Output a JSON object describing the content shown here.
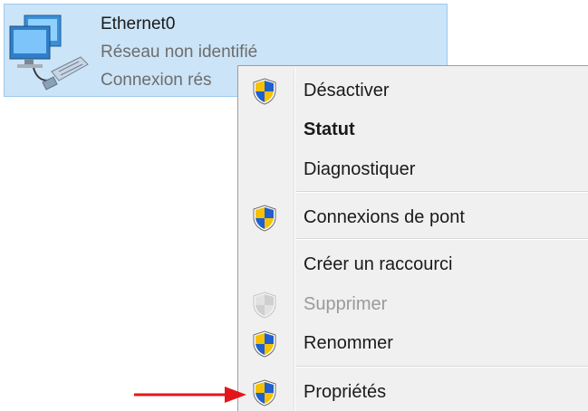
{
  "adapter": {
    "name": "Ethernet0",
    "status": "Réseau non identifié",
    "connection": "Connexion rés"
  },
  "context_menu": {
    "items": [
      {
        "label": "Désactiver",
        "shield": true,
        "bold": false,
        "disabled": false
      },
      {
        "label": "Statut",
        "shield": false,
        "bold": true,
        "disabled": false
      },
      {
        "label": "Diagnostiquer",
        "shield": false,
        "bold": false,
        "disabled": false
      },
      {
        "label": "Connexions de pont",
        "shield": true,
        "bold": false,
        "disabled": false
      },
      {
        "label": "Créer un raccourci",
        "shield": false,
        "bold": false,
        "disabled": false
      },
      {
        "label": "Supprimer",
        "shield": true,
        "bold": false,
        "disabled": true
      },
      {
        "label": "Renommer",
        "shield": true,
        "bold": false,
        "disabled": false
      },
      {
        "label": "Propriétés",
        "shield": true,
        "bold": false,
        "disabled": false
      }
    ]
  },
  "colors": {
    "selection_bg": "#cce4f7",
    "menu_bg": "#f0f0f0",
    "arrow": "#e3161b",
    "shield_blue": "#1f5fcf",
    "shield_yellow": "#f6c100"
  },
  "icons": {
    "adapter": "network-adapter-icon",
    "uac": "uac-shield-icon",
    "pointer": "red-arrow-icon"
  }
}
